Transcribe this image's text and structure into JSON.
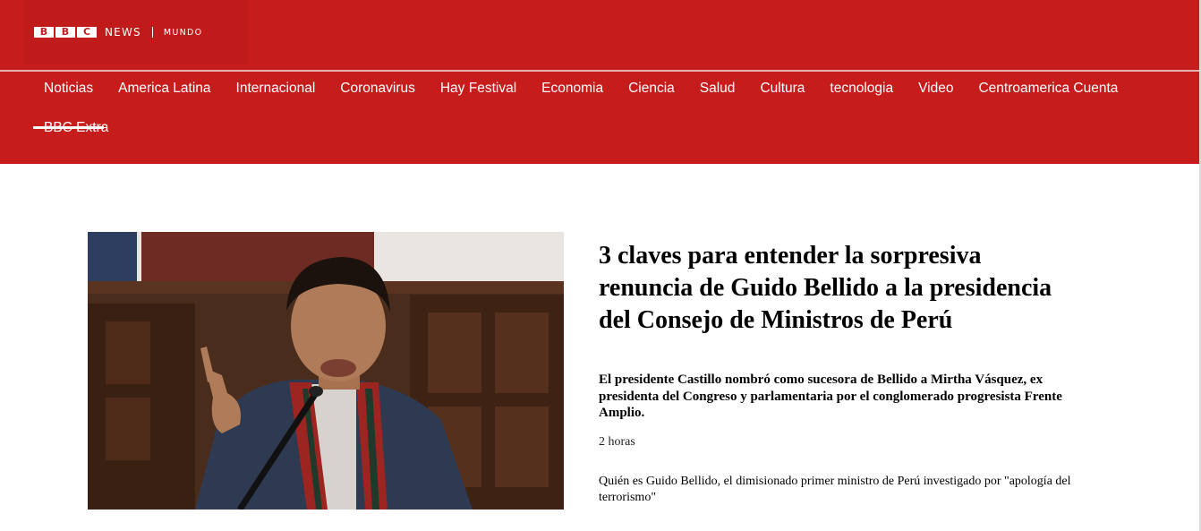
{
  "brand": {
    "letters": [
      "B",
      "B",
      "C"
    ],
    "news": "NEWS",
    "section": "MUNDO"
  },
  "nav": {
    "active": "Noticias",
    "items": [
      "Noticias",
      "America Latina",
      "Internacional",
      "Coronavirus",
      "Hay Festival",
      "Economia",
      "Ciencia",
      "Salud",
      "Cultura",
      "tecnologia",
      "Video",
      "Centroamerica Cuenta",
      "BBC Extra"
    ]
  },
  "story": {
    "headline": "3 claves para entender la sorpresiva renuncia de Guido Bellido a la presidencia del Consejo de Ministros de Perú",
    "summary": "El presidente Castillo nombró como sucesora de Bellido a Mirtha Vásquez, ex presidenta del Congreso y parlamentaria por el conglomerado progresista Frente Amplio.",
    "time": "2 horas",
    "related": "Quién es Guido Bellido, el dimisionado primer ministro de Perú investigado por \"apología del terrorismo\""
  },
  "colors": {
    "brand_red": "#c61c1c",
    "text": "#000000",
    "nav_text": "#ffffff"
  }
}
